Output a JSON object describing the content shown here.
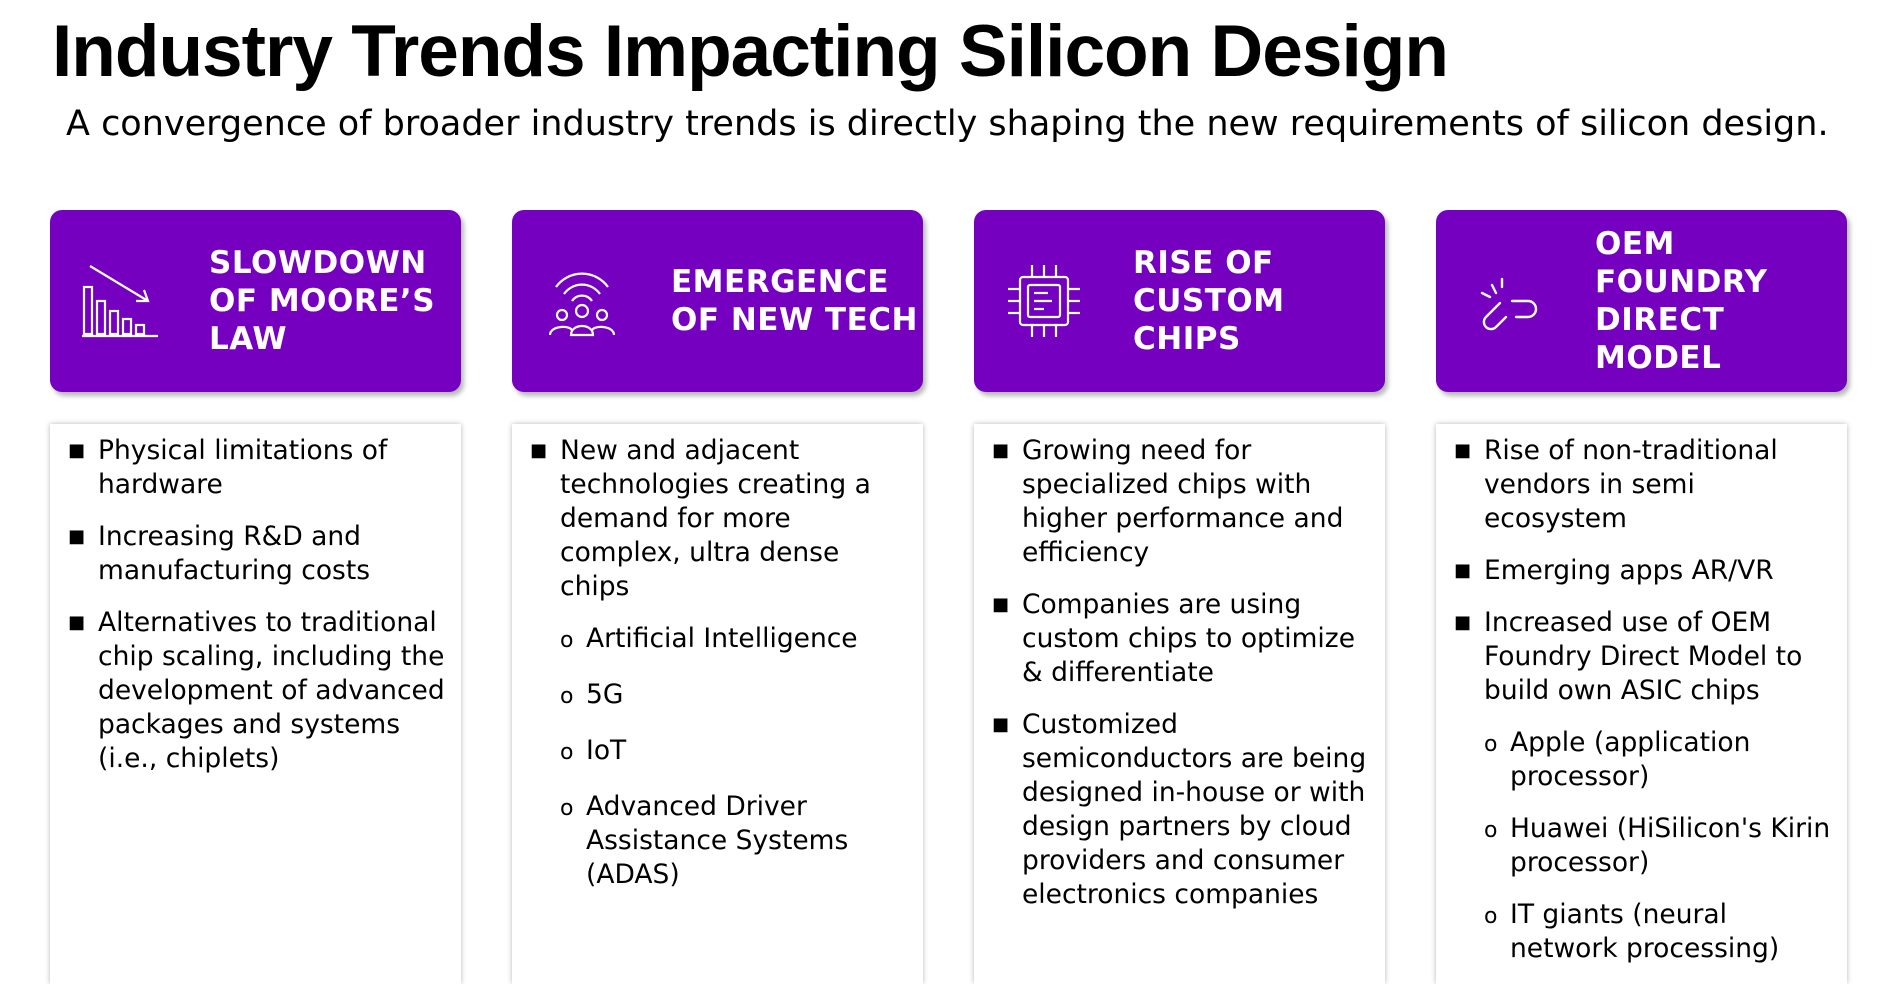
{
  "page": {
    "title": "Industry Trends Impacting Silicon Design",
    "subtitle": "A convergence of broader industry trends is directly shaping the new requirements of silicon design."
  },
  "colors": {
    "accent": "#7500c0",
    "text": "#000000",
    "header_text": "#ffffff"
  },
  "columns": [
    {
      "icon": "declining-bar-chart-icon",
      "heading": [
        "SLOWDOWN",
        "OF MOORE’S",
        "LAW"
      ],
      "bullets": [
        {
          "text": "Physical limitations of hardware"
        },
        {
          "text": "Increasing R&D and manufacturing costs"
        },
        {
          "text": "Alternatives to traditional chip scaling, including the development of advanced packages and systems (i.e., chiplets)"
        }
      ]
    },
    {
      "icon": "connected-people-icon",
      "heading": [
        "EMERGENCE",
        "OF NEW TECH"
      ],
      "bullets": [
        {
          "text": "New and adjacent technologies creating a demand for more complex, ultra dense chips",
          "subs": [
            "Artificial Intelligence",
            "5G",
            "IoT",
            "Advanced Driver Assistance Systems (ADAS)"
          ]
        }
      ]
    },
    {
      "icon": "chip-icon",
      "heading": [
        "RISE OF",
        "CUSTOM",
        "CHIPS"
      ],
      "bullets": [
        {
          "text": "Growing need for specialized chips with higher performance and efficiency"
        },
        {
          "text": "Companies are using custom chips to optimize & differentiate"
        },
        {
          "text": "Customized semiconductors are being designed in-house or with design partners by cloud providers and consumer electronics companies"
        }
      ]
    },
    {
      "icon": "broken-link-icon",
      "heading": [
        "OEM",
        "FOUNDRY",
        "DIRECT",
        "MODEL"
      ],
      "bullets": [
        {
          "text": "Rise of non-traditional vendors in semi ecosystem"
        },
        {
          "text": "Emerging apps AR/VR"
        },
        {
          "text": "Increased use of OEM Foundry Direct Model to build own ASIC chips",
          "subs": [
            "Apple (application processor)",
            "Huawei (HiSilicon's Kirin processor)",
            "IT giants (neural network processing)"
          ]
        }
      ]
    }
  ]
}
